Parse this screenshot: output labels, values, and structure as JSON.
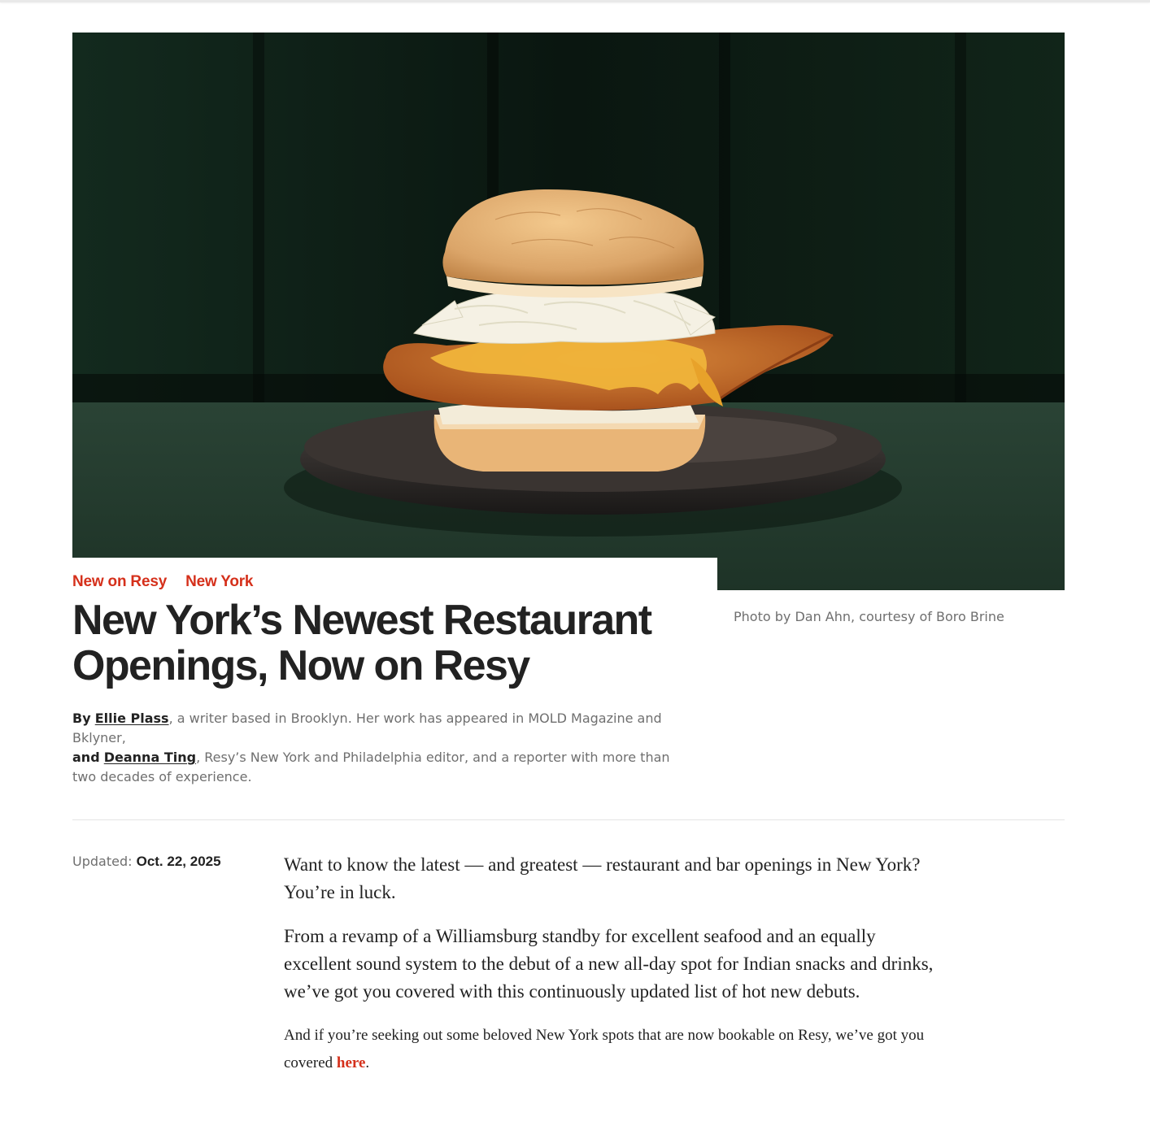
{
  "hero": {
    "caption": "Photo by Dan Ahn, courtesy of Boro Brine"
  },
  "tags": [
    "New on Resy",
    "New York"
  ],
  "article": {
    "title": "New York’s Newest Restaurant Openings, Now on Resy",
    "authors": [
      {
        "prefix": "By",
        "name": "Ellie Plass",
        "bio": ", a writer based in Brooklyn. Her work has appeared in MOLD Magazine and Bklyner,"
      },
      {
        "prefix": "and",
        "name": "Deanna Ting",
        "bio": ", Resy’s New York and Philadelphia editor, and a reporter with more than two decades of experience."
      }
    ],
    "updated_label": "Updated:",
    "updated_date": "Oct. 22, 2025",
    "paragraphs": [
      "Want to know the latest — and greatest — restaurant and bar openings in New York? You’re in luck.",
      "From a revamp of a Williamsburg standby for excellent seafood and an equally excellent sound system to the debut of a new all-day spot for Indian snacks and drinks, we’ve got you covered with this continuously updated list of hot new debuts."
    ],
    "closing": {
      "before": "And if you’re seeking out some beloved New York spots that are now bookable on Resy, we’ve got you covered ",
      "link": "here",
      "after": "."
    }
  },
  "colors": {
    "accent": "#d5301b",
    "text": "#222222",
    "muted": "#6f6f6f"
  }
}
